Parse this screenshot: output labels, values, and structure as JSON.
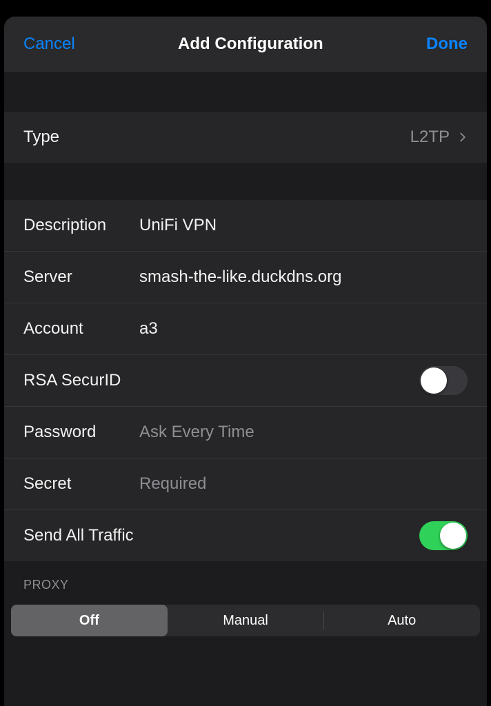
{
  "nav": {
    "cancel": "Cancel",
    "title": "Add Configuration",
    "done": "Done"
  },
  "type_row": {
    "label": "Type",
    "value": "L2TP"
  },
  "fields": {
    "description": {
      "label": "Description",
      "value": "UniFi VPN"
    },
    "server": {
      "label": "Server",
      "value": "smash-the-like.duckdns.org"
    },
    "account": {
      "label": "Account",
      "value": "a3"
    },
    "rsa": {
      "label": "RSA SecurID",
      "on": false
    },
    "password": {
      "label": "Password",
      "placeholder": "Ask Every Time"
    },
    "secret": {
      "label": "Secret",
      "placeholder": "Required"
    },
    "send_all": {
      "label": "Send All Traffic",
      "on": true
    }
  },
  "proxy": {
    "header": "Proxy",
    "options": [
      "Off",
      "Manual",
      "Auto"
    ],
    "selected": "Off"
  }
}
